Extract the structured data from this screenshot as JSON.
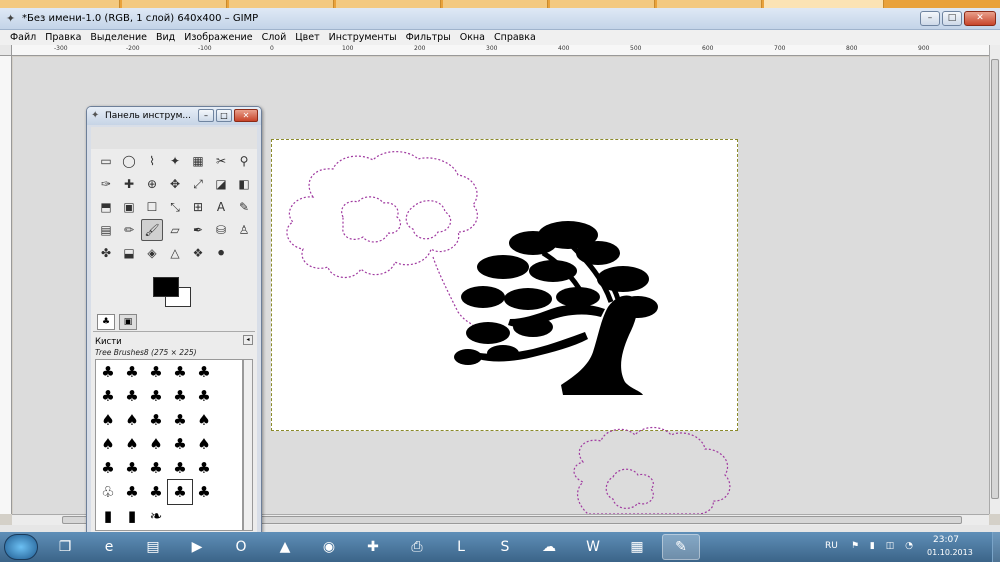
{
  "window": {
    "title": "*Без имени-1.0 (RGB, 1 слой) 640x400 – GIMP",
    "minimize": "–",
    "maximize": "□",
    "close": "✕"
  },
  "menu": [
    "Файл",
    "Правка",
    "Выделение",
    "Вид",
    "Изображение",
    "Слой",
    "Цвет",
    "Инструменты",
    "Фильтры",
    "Окна",
    "Справка"
  ],
  "ruler": {
    "top_labels": [
      "-300",
      "-200",
      "-100",
      "0",
      "100",
      "200",
      "300",
      "400",
      "500",
      "600",
      "700",
      "800",
      "900"
    ]
  },
  "toolbox": {
    "title": "Панель инструм...",
    "tools": [
      "▭",
      "◯",
      "⌇",
      "✦",
      "▦",
      "✂",
      "⚲",
      "✑",
      "✚",
      "⊕",
      "✥",
      "⤢",
      "◪",
      "◧",
      "⬒",
      "▣",
      "☐",
      "⤡",
      "⊞",
      "A",
      "✎",
      "▤",
      "✏",
      "🖌",
      "▱",
      "✒",
      "⛁",
      "♙",
      "✤",
      "⬓",
      "◈",
      "△",
      "❖",
      "⚫"
    ],
    "active_tool_index": 23,
    "brushes_title": "Кисти",
    "brush_name": "Tree Brushes8 (275 × 225)",
    "brushes": [
      "♣",
      "♣",
      "♣",
      "♣",
      "♣",
      "",
      "♣",
      "♣",
      "♣",
      "♣",
      "♣",
      "",
      "♠",
      "♠",
      "♣",
      "♣",
      "♠",
      "",
      "♠",
      "♠",
      "♠",
      "♣",
      "♠",
      "",
      "♣",
      "♣",
      "♣",
      "♣",
      "♣",
      "",
      "♧",
      "♣",
      "♣",
      "♣",
      "♣",
      "",
      "▮",
      "▮",
      "❧",
      "",
      "",
      ""
    ],
    "selected_brush_index": 33
  },
  "taskbar": {
    "apps": [
      "❐",
      "e",
      "▤",
      "▶",
      "O",
      "▲",
      "◉",
      "✚",
      "⎙",
      "L",
      "S",
      "☁",
      "W",
      "▦",
      "✎"
    ],
    "active_app_index": 14,
    "lang": "RU",
    "tray": "⚑ ▮ ◫ ◔",
    "time": "23:07",
    "date": "01.10.2013"
  }
}
